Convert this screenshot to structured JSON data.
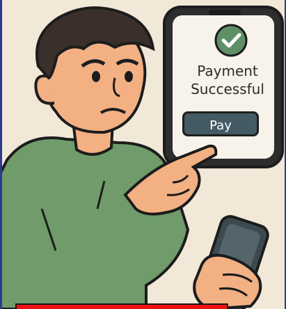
{
  "phone_screen": {
    "status_title_line1": "Payment",
    "status_title_line2": "Successful",
    "pay_button_label": "Pay"
  },
  "icons": {
    "success": "check-circle-icon"
  },
  "colors": {
    "background": "#f2e8d8",
    "shirt": "#6f9c6a",
    "skin": "#f2b083",
    "hair": "#3a2f2a",
    "success_circle": "#5f8f66",
    "pay_button": "#445b65",
    "bottom_bar": "#ee1111",
    "frame_border": "#2b3a8f"
  }
}
